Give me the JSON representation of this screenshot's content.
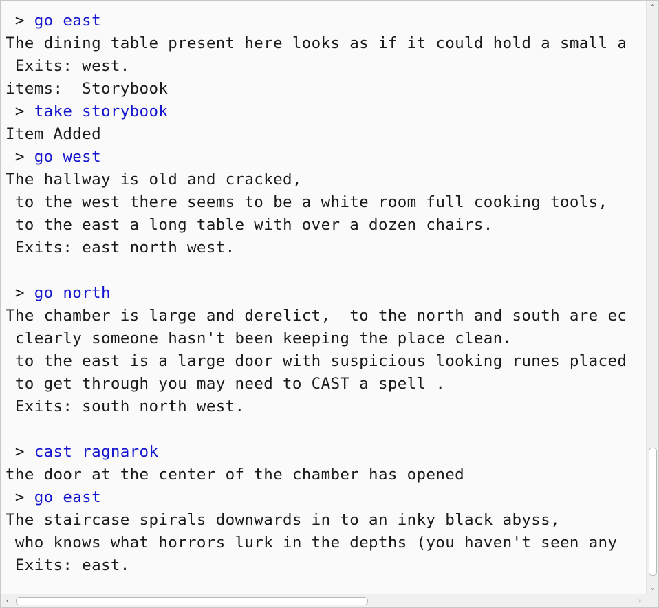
{
  "console": {
    "lines": [
      {
        "prompt": " > ",
        "text": "go east",
        "type": "command"
      },
      {
        "text": "The dining table present here looks as if it could hold a small a",
        "type": "output"
      },
      {
        "text": " Exits: west.",
        "type": "output"
      },
      {
        "text": "items:  Storybook",
        "type": "output"
      },
      {
        "prompt": " > ",
        "text": "take storybook",
        "type": "command"
      },
      {
        "text": "Item Added",
        "type": "output"
      },
      {
        "prompt": " > ",
        "text": "go west",
        "type": "command"
      },
      {
        "text": "The hallway is old and cracked,",
        "type": "output"
      },
      {
        "text": " to the west there seems to be a white room full cooking tools,",
        "type": "output"
      },
      {
        "text": " to the east a long table with over a dozen chairs.",
        "type": "output"
      },
      {
        "text": " Exits: east north west.",
        "type": "output"
      },
      {
        "text": "",
        "type": "output"
      },
      {
        "prompt": " > ",
        "text": "go north",
        "type": "command"
      },
      {
        "text": "The chamber is large and derelict,  to the north and south are ec",
        "type": "output"
      },
      {
        "text": " clearly someone hasn't been keeping the place clean.",
        "type": "output"
      },
      {
        "text": " to the east is a large door with suspicious looking runes placed",
        "type": "output"
      },
      {
        "text": " to get through you may need to CAST a spell .",
        "type": "output"
      },
      {
        "text": " Exits: south north west.",
        "type": "output"
      },
      {
        "text": "",
        "type": "output"
      },
      {
        "prompt": " > ",
        "text": "cast ragnarok",
        "type": "command"
      },
      {
        "text": "the door at the center of the chamber has opened",
        "type": "output"
      },
      {
        "prompt": " > ",
        "text": "go east",
        "type": "command"
      },
      {
        "text": "The staircase spirals downwards in to an inky black abyss,",
        "type": "output"
      },
      {
        "text": " who knows what horrors lurk in the depths (you haven't seen any",
        "type": "output"
      },
      {
        "text": " Exits: east.",
        "type": "output"
      }
    ]
  },
  "scrollbars": {
    "vertical": {
      "up_icon": "chevron-up-icon",
      "down_icon": "chevron-down-icon",
      "up_glyph": "⌃",
      "down_glyph": "⌄",
      "position_fraction": 0.82
    },
    "horizontal": {
      "left_icon": "chevron-left-icon",
      "right_icon": "chevron-right-icon",
      "left_glyph": "‹",
      "right_glyph": "›",
      "position_fraction": 0.0
    }
  },
  "colors": {
    "command": "#1515d0",
    "output": "#1a1a1a",
    "background": "#fafafa"
  }
}
